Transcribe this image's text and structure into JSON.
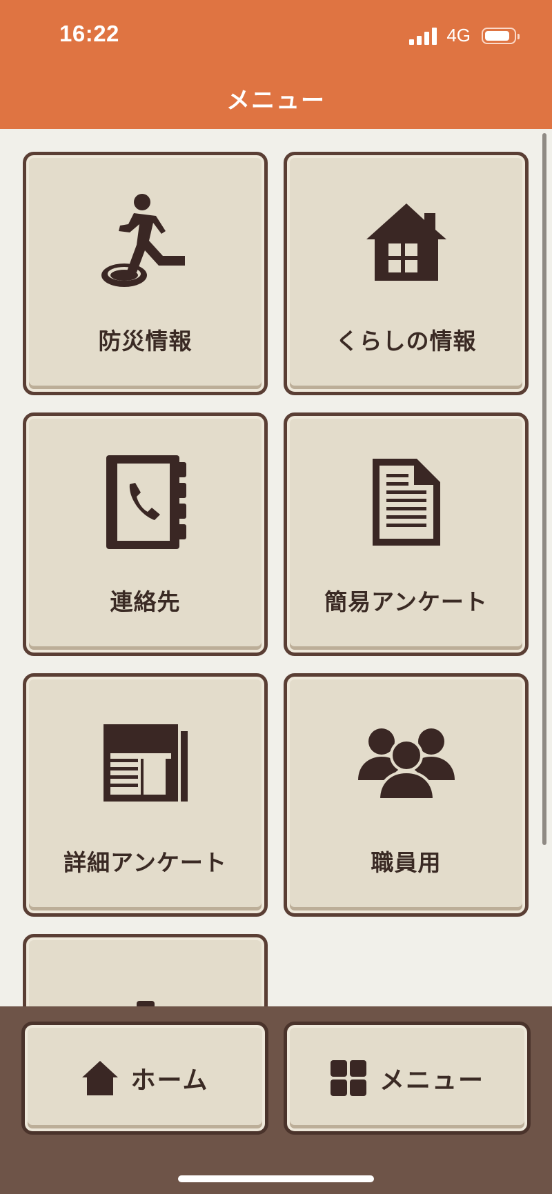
{
  "status": {
    "time": "16:22",
    "network": "4G"
  },
  "header": {
    "title": "メニュー"
  },
  "tiles": [
    {
      "label": "防災情報",
      "icon": "emergency-exit-icon"
    },
    {
      "label": "くらしの情報",
      "icon": "house-icon"
    },
    {
      "label": "連絡先",
      "icon": "phone-book-icon"
    },
    {
      "label": "簡易アンケート",
      "icon": "document-icon"
    },
    {
      "label": "詳細アンケート",
      "icon": "newspaper-icon"
    },
    {
      "label": "職員用",
      "icon": "staff-group-icon"
    },
    {
      "label": "",
      "icon": "gear-icon"
    }
  ],
  "tabbar": {
    "home_label": "ホーム",
    "menu_label": "メニュー"
  },
  "colors": {
    "header": "#df7442",
    "tile_bg": "#e3dccb",
    "tile_border": "#5a3e34",
    "icon": "#3a2724",
    "tabbar_bg": "#6e5448"
  }
}
